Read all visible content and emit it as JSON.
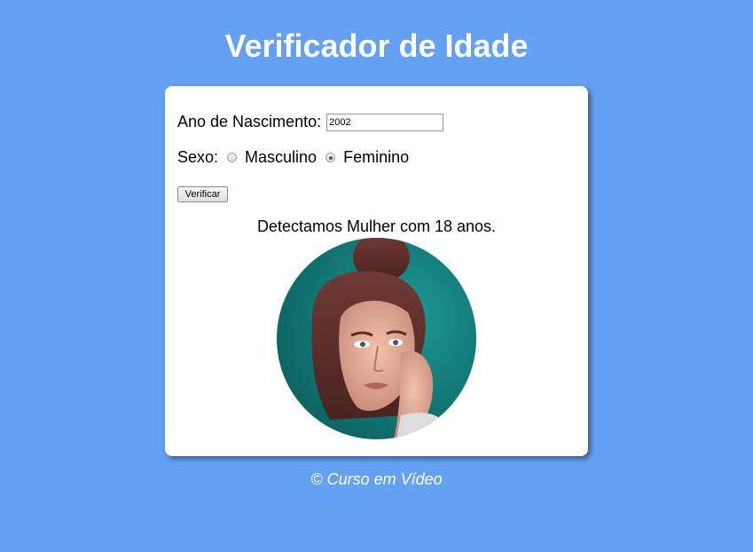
{
  "header": {
    "title": "Verificador de Idade"
  },
  "form": {
    "year_label": "Ano de Nascimento:",
    "year_value": "2002",
    "sex_label": "Sexo:",
    "sex_options": [
      {
        "label": "Masculino",
        "checked": false
      },
      {
        "label": "Feminino",
        "checked": true
      }
    ],
    "verify_label": "Verificar"
  },
  "result": {
    "text": "Detectamos Mulher com 18 anos.",
    "photo_icon": "woman-photo"
  },
  "footer": {
    "text": "© Curso em Vídeo"
  },
  "colors": {
    "background": "#64a1f2",
    "card": "#ffffff",
    "title": "#ffffff"
  }
}
